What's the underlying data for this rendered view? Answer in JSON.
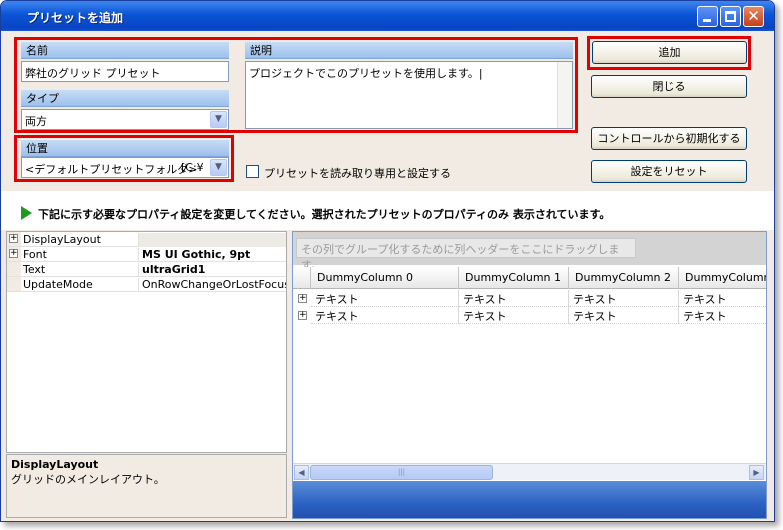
{
  "window": {
    "title": "プリセットを追加"
  },
  "form": {
    "name_label": "名前",
    "name_value": "弊社のグリッド プリセット",
    "type_label": "タイプ",
    "type_value": "両方",
    "desc_label": "説明",
    "desc_value": "プロジェクトでこのプリセットを使用します。|",
    "location_label": "位置",
    "location_value": "<デフォルトプリセットフォルダ>",
    "location_path": "[C:¥",
    "readonly_label": "プリセットを読み取り専用と設定する",
    "readonly_checked": false
  },
  "buttons": {
    "add": "追加",
    "close": "閉じる",
    "init_from_control": "コントロールから初期化する",
    "reset": "設定をリセット"
  },
  "message": "下記に示す必要なプロパティ設定を変更してください。選択されたプリセットのプロパティのみ 表示されています。",
  "properties": [
    {
      "name": "DisplayLayout",
      "value": "",
      "expandable": true,
      "bold": false
    },
    {
      "name": "Font",
      "value": "MS UI Gothic, 9pt",
      "expandable": true,
      "bold": true
    },
    {
      "name": "Text",
      "value": "ultraGrid1",
      "expandable": false,
      "bold": true
    },
    {
      "name": "UpdateMode",
      "value": "OnRowChangeOrLostFocus",
      "expandable": false,
      "bold": false
    }
  ],
  "description_panel": {
    "title": "DisplayLayout",
    "text": "グリッドのメインレイアウト。"
  },
  "grid": {
    "group_prompt": "その列でグループ化するために列ヘッダーをここにドラッグします。",
    "columns": [
      "DummyColumn 0",
      "DummyColumn 1",
      "DummyColumn 2",
      "DummyColumn"
    ],
    "rows": [
      [
        "テキスト",
        "テキスト",
        "テキスト",
        "テキスト"
      ],
      [
        "テキスト",
        "テキスト",
        "テキスト",
        "テキスト"
      ]
    ]
  },
  "colors": {
    "title_bar": "#0a54d6",
    "highlight_border": "#e00000",
    "section_header": "#9dc0ec",
    "message_arrow": "#1e9a1e",
    "grid_footer": "#2b61c2"
  },
  "icons": {
    "minimize": "minimize-icon",
    "maximize": "maximize-icon",
    "close": "close-icon",
    "dropdown": "chevron-down-icon",
    "message": "play-arrow-icon",
    "expand": "plus-icon"
  }
}
